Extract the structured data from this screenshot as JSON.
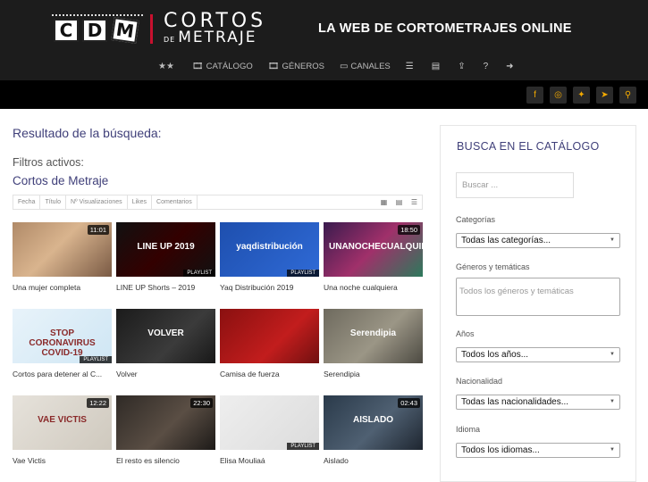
{
  "header": {
    "logo_letters": [
      "C",
      "D",
      "M"
    ],
    "logo_line1": "CORTOS",
    "logo_de": "DE",
    "logo_line2": "METRAJE",
    "tagline": "LA WEB DE CORTOMETRAJES ONLINE",
    "nav": [
      {
        "icon": "stars-icon",
        "glyph": "★★",
        "label": ""
      },
      {
        "icon": "film-icon",
        "glyph": "🎞",
        "label": "CATÁLOGO"
      },
      {
        "icon": "film-icon",
        "glyph": "🎞",
        "label": "GÉNEROS"
      },
      {
        "icon": "monitor-icon",
        "glyph": "▭",
        "label": "CANALES"
      },
      {
        "icon": "list-icon",
        "glyph": "☰",
        "label": ""
      },
      {
        "icon": "card-icon",
        "glyph": "▤",
        "label": ""
      },
      {
        "icon": "upload-icon",
        "glyph": "⇪",
        "label": ""
      },
      {
        "icon": "question-icon",
        "glyph": "?",
        "label": ""
      },
      {
        "icon": "sign-out-icon",
        "glyph": "➜",
        "label": ""
      }
    ],
    "social": [
      {
        "icon": "facebook-icon",
        "glyph": "f"
      },
      {
        "icon": "instagram-icon",
        "glyph": "◎"
      },
      {
        "icon": "twitter-icon",
        "glyph": "✦"
      },
      {
        "icon": "telegram-icon",
        "glyph": "➤"
      },
      {
        "icon": "search-icon",
        "glyph": "⚲"
      }
    ]
  },
  "main": {
    "title": "Resultado de la búsqueda:",
    "filters_label": "Filtros activos:",
    "filter_value": "Cortos de Metraje",
    "sort": [
      "Fecha",
      "Título",
      "Nº Visualizaciones",
      "Likes",
      "Comentarios"
    ],
    "view_icons": [
      "grid-large-icon",
      "grid-small-icon",
      "list-view-icon"
    ],
    "cards": [
      {
        "title": "Una mujer completa",
        "duration": "11:01",
        "playlist": "",
        "thumb_text": "",
        "bg": "linear-gradient(135deg,#b08a68,#d9b48e 45%,#7a5a44)"
      },
      {
        "title": "LINE UP Shorts – 2019",
        "duration": "",
        "playlist": "PLAYLIST",
        "thumb_text": "LINE UP   2019",
        "bg": "linear-gradient(135deg,#111,#300 50%,#111)"
      },
      {
        "title": "Yaq Distribución 2019",
        "duration": "",
        "playlist": "PLAYLIST",
        "thumb_text": "yaqdistribución",
        "bg": "linear-gradient(135deg,#1e4fae,#2f6ad6)"
      },
      {
        "title": "Una noche cualquiera",
        "duration": "18:50",
        "playlist": "",
        "thumb_text": "UNANOCHECUALQUIERA",
        "bg": "linear-gradient(135deg,#3a1b4e,#a0306a 50%,#2c7a5c)"
      },
      {
        "title": "Cortos para detener al C...",
        "duration": "",
        "playlist": "PLAYLIST",
        "thumb_text": "STOP CORONAVIRUS COVID-19",
        "bg": "linear-gradient(135deg,#e8f3fa,#cfe6f4)"
      },
      {
        "title": "Volver",
        "duration": "",
        "playlist": "",
        "thumb_text": "VOLVER",
        "bg": "linear-gradient(135deg,#1b1b1b,#3b3b3b 60%,#181818)"
      },
      {
        "title": "Camisa de fuerza",
        "duration": "",
        "playlist": "",
        "thumb_text": "",
        "bg": "linear-gradient(135deg,#8a1010,#c21d1d 60%,#701010)"
      },
      {
        "title": "Serendipia",
        "duration": "",
        "playlist": "",
        "thumb_text": "Serendipia",
        "bg": "linear-gradient(135deg,#6e6a5e,#9b9686 55%,#4d4a42)"
      },
      {
        "title": "Vae Victis",
        "duration": "12:22",
        "playlist": "",
        "thumb_text": "VAE VICTIS",
        "bg": "linear-gradient(135deg,#e6e2db,#cfc9be)"
      },
      {
        "title": "El resto es silencio",
        "duration": "22:30",
        "playlist": "",
        "thumb_text": "",
        "bg": "linear-gradient(135deg,#2f2a26,#5a4e44 55%,#1d1a18)"
      },
      {
        "title": "Elisa Mouliaá",
        "duration": "",
        "playlist": "PLAYLIST",
        "thumb_text": "",
        "bg": "linear-gradient(135deg,#eeeeee,#dcdcdc)"
      },
      {
        "title": "Aislado",
        "duration": "02:43",
        "playlist": "",
        "thumb_text": "AISLADO",
        "bg": "linear-gradient(135deg,#2a3a4a,#4f6072 55%,#1e2630)"
      }
    ]
  },
  "sidebar": {
    "title": "BUSCA EN EL CATÁLOGO",
    "search_placeholder": "Buscar ...",
    "categories_label": "Categorías",
    "categories_value": "Todas las categorías...",
    "genres_label": "Géneros y temáticas",
    "genres_placeholder": "Todos los géneros y temáticas",
    "years_label": "Años",
    "years_value": "Todos los años...",
    "nationality_label": "Nacionalidad",
    "nationality_value": "Todas las nacionalidades...",
    "language_label": "Idioma",
    "language_value": "Todos los idiomas..."
  }
}
